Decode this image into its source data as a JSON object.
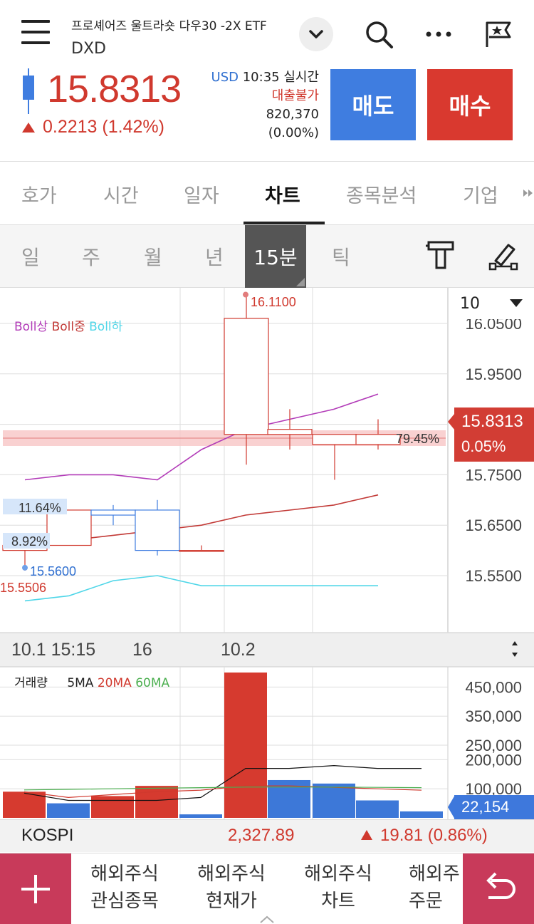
{
  "header": {
    "stock_name": "프로셰어즈 울트라숏 다우30 -2X ETF",
    "stock_code": "DXD",
    "price": "15.8313",
    "change": "0.2213 (1.42%)",
    "currency": "USD",
    "time_status": "10:35 실시간",
    "loan_status": "대출불가",
    "volume": "820,370",
    "volume_pct": "(0.00%)",
    "sell_label": "매도",
    "buy_label": "매수",
    "colors": {
      "up": "#d0392e",
      "down": "#3f7de0"
    }
  },
  "tabs": [
    {
      "label": "호가"
    },
    {
      "label": "시간"
    },
    {
      "label": "일자"
    },
    {
      "label": "차트",
      "active": true
    },
    {
      "label": "종목분석"
    },
    {
      "label": "기업"
    }
  ],
  "period_tabs": [
    {
      "label": "일"
    },
    {
      "label": "주"
    },
    {
      "label": "월"
    },
    {
      "label": "년"
    },
    {
      "label": "15분",
      "active": true
    },
    {
      "label": "틱"
    }
  ],
  "chart": {
    "period_count": "10",
    "legend": {
      "upper": "Boll상",
      "middle": "Boll중",
      "lower": "Boll하"
    },
    "price_ticks": [
      "16.0500",
      "15.9500",
      "15.7500",
      "15.6500",
      "15.5500"
    ],
    "current_price": "15.8313",
    "current_pct": "0.05%",
    "high_label": "16.1100",
    "low_label_1": "15.5600",
    "low_label_2": "15.5506",
    "pct_labels": [
      "11.64%",
      "8.92%",
      "79.45%"
    ],
    "x_labels": [
      "10.1 15:15",
      "16",
      "10.2"
    ],
    "volume_legend": {
      "vol": "거래량",
      "ma5": "5MA",
      "ma20": "20MA",
      "ma60": "60MA"
    },
    "volume_ticks": [
      "450,000",
      "350,000",
      "250,000",
      "200,000",
      "100,000"
    ],
    "current_volume": "22,154"
  },
  "chart_data": [
    {
      "type": "candlestick",
      "ylim": [
        15.5,
        16.11
      ],
      "series": [
        {
          "name": "price",
          "values": [
            {
              "open": 15.6,
              "high": 15.61,
              "low": 15.56,
              "close": 15.61
            },
            {
              "open": 15.61,
              "high": 15.68,
              "low": 15.61,
              "close": 15.68
            },
            {
              "open": 15.68,
              "high": 15.69,
              "low": 15.65,
              "close": 15.67
            },
            {
              "open": 15.68,
              "high": 15.7,
              "low": 15.59,
              "close": 15.6
            },
            {
              "open": 15.6,
              "high": 15.61,
              "low": 15.6,
              "close": 15.6
            },
            {
              "open": 15.83,
              "high": 16.11,
              "low": 15.77,
              "close": 16.06
            },
            {
              "open": 15.83,
              "high": 15.88,
              "low": 15.8,
              "close": 15.84
            },
            {
              "open": 15.81,
              "high": 15.83,
              "low": 15.74,
              "close": 15.83
            },
            {
              "open": 15.81,
              "high": 15.86,
              "low": 15.8,
              "close": 15.83
            }
          ]
        },
        {
          "name": "Boll상",
          "values": [
            15.74,
            15.75,
            15.75,
            15.74,
            15.8,
            15.84,
            15.86,
            15.88,
            15.91
          ]
        },
        {
          "name": "Boll중",
          "values": [
            15.61,
            15.62,
            15.63,
            15.64,
            15.65,
            15.67,
            15.68,
            15.69,
            15.71
          ]
        },
        {
          "name": "Boll하",
          "values": [
            15.5,
            15.51,
            15.54,
            15.55,
            15.53,
            15.53,
            15.53,
            15.53,
            15.53
          ]
        }
      ]
    },
    {
      "type": "bar",
      "ylim": [
        0,
        500000
      ],
      "series": [
        {
          "name": "거래량",
          "values": [
            {
              "v": 90000,
              "dir": "up"
            },
            {
              "v": 50000,
              "dir": "down"
            },
            {
              "v": 75000,
              "dir": "up"
            },
            {
              "v": 110000,
              "dir": "up"
            },
            {
              "v": 12000,
              "dir": "down"
            },
            {
              "v": 500000,
              "dir": "up"
            },
            {
              "v": 130000,
              "dir": "down"
            },
            {
              "v": 118000,
              "dir": "down"
            },
            {
              "v": 60000,
              "dir": "down"
            },
            {
              "v": 22154,
              "dir": "down"
            }
          ]
        },
        {
          "name": "5MA",
          "values": [
            85000,
            60000,
            60000,
            60000,
            70000,
            170000,
            170000,
            180000,
            170000,
            170000
          ]
        },
        {
          "name": "20MA",
          "values": [
            90000,
            70000,
            80000,
            90000,
            95000,
            110000,
            110000,
            105000,
            100000,
            95000
          ]
        },
        {
          "name": "60MA",
          "values": [
            96000,
            98000,
            100000,
            102000,
            104000,
            106000,
            106000,
            106000,
            105000,
            104000
          ]
        }
      ]
    }
  ],
  "index_bar": {
    "name": "KOSPI",
    "value": "2,327.89",
    "change": "19.81 (0.86%)"
  },
  "bottom_nav": [
    {
      "line1": "해외주식",
      "line2": "관심종목"
    },
    {
      "line1": "해외주식",
      "line2": "현재가"
    },
    {
      "line1": "해외주식",
      "line2": "차트"
    },
    {
      "line1": "해외주",
      "line2": "주문"
    }
  ]
}
